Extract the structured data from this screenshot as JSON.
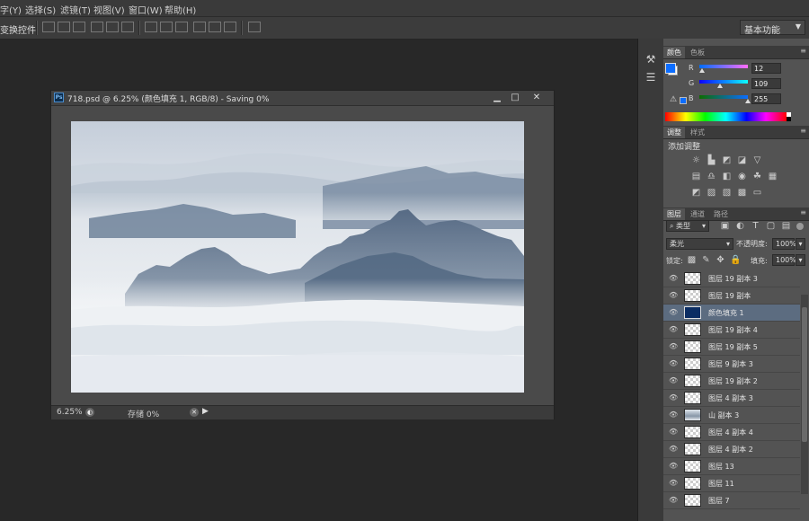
{
  "menu": [
    "字(Y)",
    "选择(S)",
    "滤镜(T)",
    "视图(V)",
    "窗口(W)",
    "帮助(H)"
  ],
  "options": {
    "show_transform_label": "变换控件",
    "workspace": "基本功能"
  },
  "document": {
    "title": "718.psd @ 6.25% (颜色填充 1, RGB/8) - Saving 0%",
    "zoom": "6.25%",
    "save_status": "存储 0%"
  },
  "panels": {
    "color": {
      "tabs": [
        "颜色",
        "色板"
      ],
      "foreground": "#0c6dff",
      "background": "#ffffff",
      "r_label": "R",
      "g_label": "G",
      "b_label": "B",
      "r": "12",
      "g": "109",
      "b": "255",
      "r_level": 0.05,
      "g_level": 0.43,
      "b_level": 1.0
    },
    "adjustments": {
      "tabs": [
        "调整",
        "样式"
      ],
      "title": "添加调整"
    },
    "layers": {
      "tabs": [
        "图层",
        "通道",
        "路径"
      ],
      "filter_kind": "类型",
      "blend_mode": "柔光",
      "opacity_label": "不透明度:",
      "opacity": "100%",
      "lock_label": "锁定:",
      "fill_label": "填充:",
      "fill": "100%",
      "items": [
        {
          "name": "图层 19 副本 3",
          "thumb": "transparent",
          "selected": false
        },
        {
          "name": "图层 19 副本",
          "thumb": "transparent",
          "selected": false
        },
        {
          "name": "颜色填充 1",
          "thumb": "fill",
          "selected": true
        },
        {
          "name": "图层 19 副本 4",
          "thumb": "transparent",
          "selected": false
        },
        {
          "name": "图层 19 副本 5",
          "thumb": "transparent",
          "selected": false
        },
        {
          "name": "图层 9 副本 3",
          "thumb": "transparent",
          "selected": false
        },
        {
          "name": "图层 19 副本 2",
          "thumb": "transparent",
          "selected": false
        },
        {
          "name": "图层 4 副本 3",
          "thumb": "transparent",
          "selected": false
        },
        {
          "name": "山 副本 3",
          "thumb": "mountain",
          "selected": false
        },
        {
          "name": "图层 4 副本 4",
          "thumb": "transparent",
          "selected": false
        },
        {
          "name": "图层 4 副本 2",
          "thumb": "transparent",
          "selected": false
        },
        {
          "name": "图层 13",
          "thumb": "transparent",
          "selected": false
        },
        {
          "name": "图层 11",
          "thumb": "transparent",
          "selected": false
        },
        {
          "name": "图层 7",
          "thumb": "transparent",
          "selected": false
        }
      ]
    }
  }
}
